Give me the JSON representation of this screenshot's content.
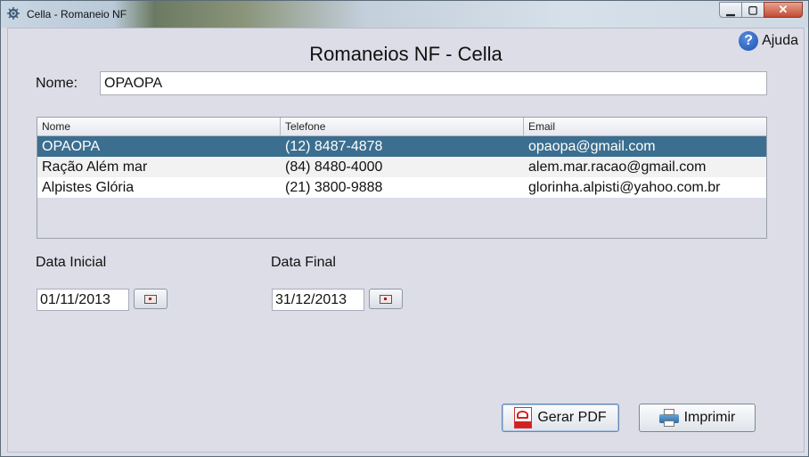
{
  "window": {
    "title": "Cella - Romaneio NF",
    "minimize_glyph": "▁",
    "maximize_glyph": "▢",
    "close_glyph": "✕"
  },
  "help": {
    "label": "Ajuda",
    "glyph": "?"
  },
  "page": {
    "title": "Romaneios NF - Cella"
  },
  "search": {
    "label": "Nome:",
    "value": "OPAOPA"
  },
  "table": {
    "headers": [
      "Nome",
      "Telefone",
      "Email"
    ],
    "rows": [
      {
        "nome": "OPAOPA",
        "telefone": "(12) 8487-4878",
        "email": "opaopa@gmail.com",
        "selected": true
      },
      {
        "nome": "Ração Além mar",
        "telefone": "(84) 8480-4000",
        "email": "alem.mar.racao@gmail.com"
      },
      {
        "nome": "Alpistes Glória",
        "telefone": "(21) 3800-9888",
        "email": "glorinha.alpisti@yahoo.com.br"
      }
    ]
  },
  "dates": {
    "inicial": {
      "label": "Data Inicial",
      "value": "01/11/2013"
    },
    "final": {
      "label": "Data Final",
      "value": "31/12/2013"
    }
  },
  "actions": {
    "pdf_label": "Gerar PDF",
    "print_label": "Imprimir"
  },
  "colors": {
    "selection": "#3b6e8f",
    "window_bg": "#dcdde6"
  }
}
